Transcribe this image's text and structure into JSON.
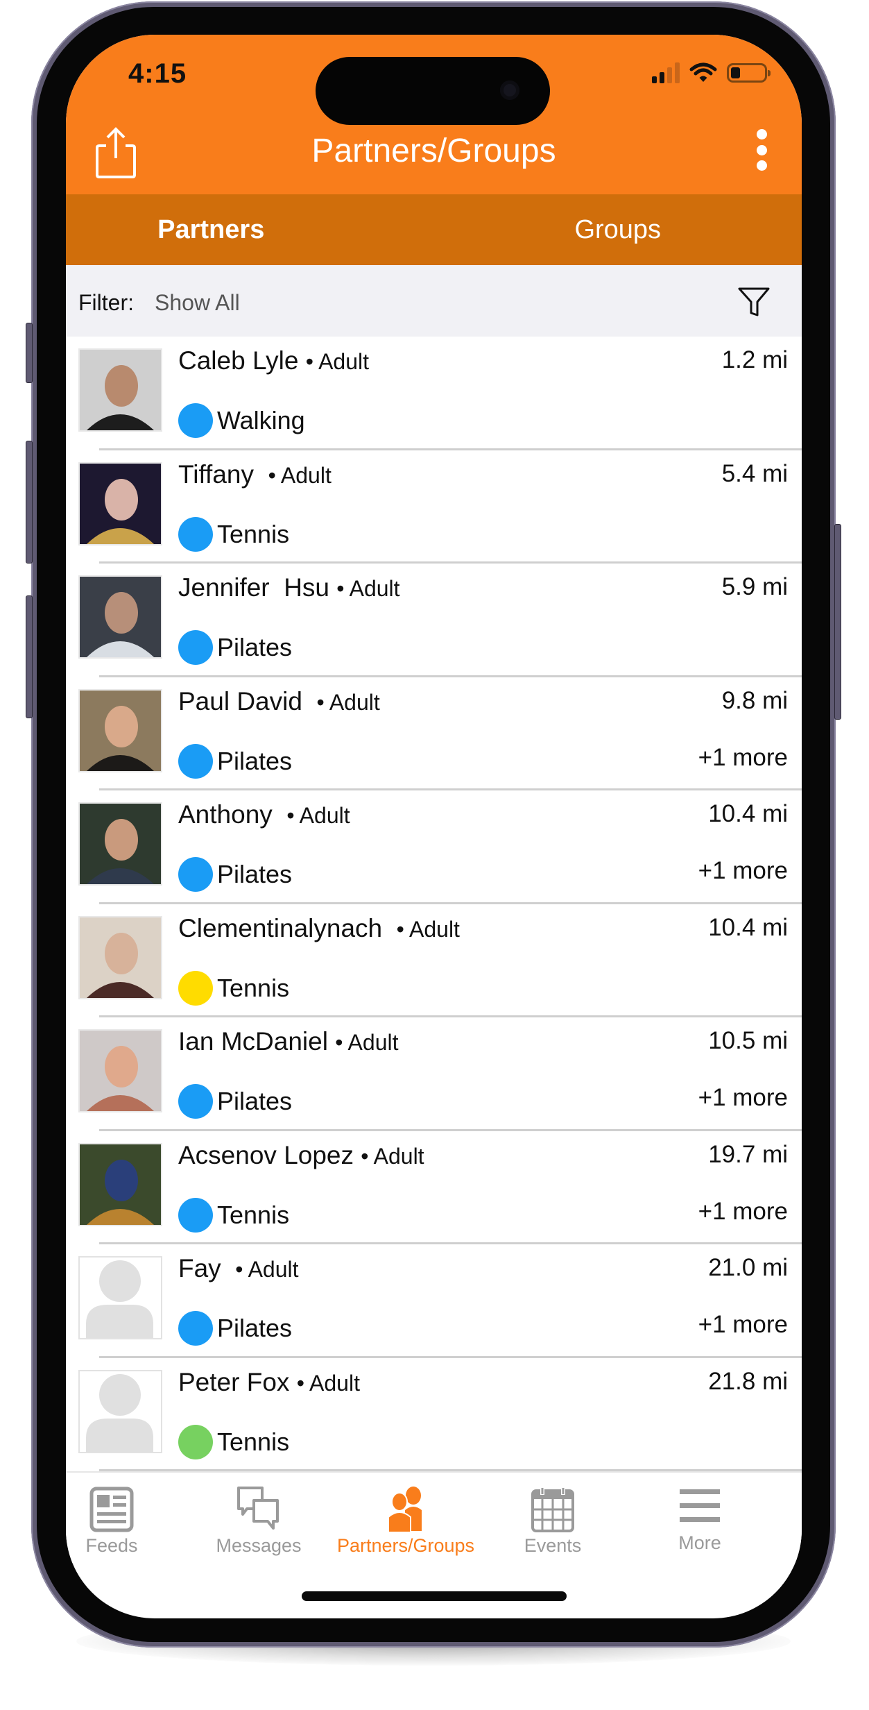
{
  "status_bar": {
    "time": "4:15",
    "signal_bars_filled": 2,
    "signal_bars_total": 4,
    "battery_level": 0.2
  },
  "header": {
    "title": "Partners/Groups",
    "share_icon": "share-icon",
    "menu_icon": "more-vertical-icon"
  },
  "segments": [
    {
      "label": "Partners",
      "active": true
    },
    {
      "label": "Groups",
      "active": false
    }
  ],
  "filter": {
    "label": "Filter:",
    "value": "Show All",
    "icon": "filter-icon"
  },
  "partners": [
    {
      "name": "Caleb Lyle",
      "tag": "• Adult",
      "distance": "1.2 mi",
      "activity": "Walking",
      "activity_color": "#1a9cf5",
      "more": "",
      "avatar": "photo",
      "photo_tint": [
        "#cfcfcf",
        "#1d1d1d",
        "#b88a6e"
      ]
    },
    {
      "name": "Tiffany ",
      "tag": "• Adult",
      "distance": "5.4 mi",
      "activity": "Tennis",
      "activity_color": "#1a9cf5",
      "more": "",
      "avatar": "photo",
      "photo_tint": [
        "#1d1830",
        "#c9a24a",
        "#d9b3a8"
      ]
    },
    {
      "name": "Jennifer  Hsu",
      "tag": "• Adult",
      "distance": "5.9 mi",
      "activity": "Pilates",
      "activity_color": "#1a9cf5",
      "more": "",
      "avatar": "photo",
      "photo_tint": [
        "#3a3f48",
        "#d8dde3",
        "#b78f79"
      ]
    },
    {
      "name": "Paul David ",
      "tag": "• Adult",
      "distance": "9.8 mi",
      "activity": "Pilates",
      "activity_color": "#1a9cf5",
      "more": "+1 more",
      "avatar": "photo",
      "photo_tint": [
        "#8c7a5e",
        "#1c1a18",
        "#d9a98a"
      ]
    },
    {
      "name": "Anthony ",
      "tag": "• Adult",
      "distance": "10.4 mi",
      "activity": "Pilates",
      "activity_color": "#1a9cf5",
      "more": "+1 more",
      "avatar": "photo",
      "photo_tint": [
        "#2e3a2f",
        "#2f3a4c",
        "#c99a7d"
      ]
    },
    {
      "name": "Clementinalynach ",
      "tag": "• Adult",
      "distance": "10.4 mi",
      "activity": "Tennis",
      "activity_color": "#ffdc00",
      "more": "",
      "avatar": "photo",
      "photo_tint": [
        "#dcd2c6",
        "#4a2a26",
        "#d7b29a"
      ]
    },
    {
      "name": "Ian McDaniel",
      "tag": "• Adult",
      "distance": "10.5 mi",
      "activity": "Pilates",
      "activity_color": "#1a9cf5",
      "more": "+1 more",
      "avatar": "photo",
      "photo_tint": [
        "#cfc9c8",
        "#b5705a",
        "#e0a98c"
      ]
    },
    {
      "name": "Acsenov Lopez",
      "tag": "• Adult",
      "distance": "19.7 mi",
      "activity": "Tennis",
      "activity_color": "#1a9cf5",
      "more": "+1 more",
      "avatar": "photo",
      "photo_tint": [
        "#3b4a2c",
        "#b9822f",
        "#2a3f7a"
      ]
    },
    {
      "name": "Fay ",
      "tag": "• Adult",
      "distance": "21.0 mi",
      "activity": "Pilates",
      "activity_color": "#1a9cf5",
      "more": "+1 more",
      "avatar": "placeholder",
      "photo_tint": []
    },
    {
      "name": "Peter Fox",
      "tag": "• Adult",
      "distance": "21.8 mi",
      "activity": "Tennis",
      "activity_color": "#77d160",
      "more": "",
      "avatar": "placeholder",
      "photo_tint": []
    }
  ],
  "tabbar": [
    {
      "label": "Feeds",
      "icon": "newspaper-icon",
      "active": false
    },
    {
      "label": "Messages",
      "icon": "chat-bubbles-icon",
      "active": false
    },
    {
      "label": "Partners/Groups",
      "icon": "people-icon",
      "active": true
    },
    {
      "label": "Events",
      "icon": "calendar-icon",
      "active": false
    },
    {
      "label": "More",
      "icon": "hamburger-menu-icon",
      "active": false
    }
  ],
  "colors": {
    "accent": "#f97d1b",
    "segment_bg": "#d06e0b",
    "filter_bg": "#f1f1f5",
    "inactive_tab": "#9a9a9a"
  }
}
